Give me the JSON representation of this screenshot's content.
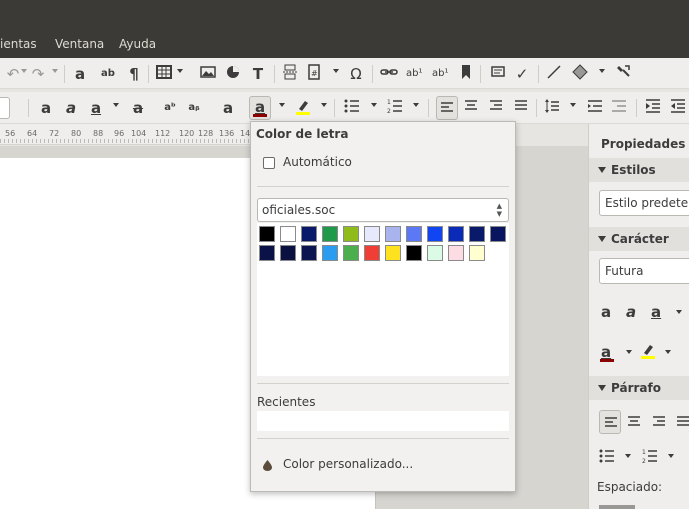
{
  "menubar": {
    "items": [
      "ientas",
      "Ventana",
      "Ayuda"
    ]
  },
  "toolbar1": {
    "icons": [
      "undo-icon",
      "redo-icon",
      "find-replace-icon",
      "spelling-icon",
      "formatting-marks-icon",
      "table-icon",
      "image-icon",
      "chart-icon",
      "textbox-icon",
      "page-break-icon",
      "field-icon",
      "special-character-icon",
      "hyperlink-icon",
      "footnote-icon",
      "endnote-icon",
      "bookmark-icon",
      "comment-icon",
      "track-changes-icon",
      "line-icon",
      "shapes-icon",
      "basic-shapes-icon",
      "clone-formatting-icon"
    ],
    "symbols": {
      "omega": "Ω",
      "pilcrow": "¶",
      "T": "T"
    }
  },
  "toolbar2": {
    "icons": [
      "bold-icon",
      "italic-icon",
      "underline-icon",
      "strikethrough-icon",
      "superscript-icon",
      "subscript-icon",
      "clear-formatting-icon",
      "font-color-icon",
      "highlight-icon",
      "bullets-icon",
      "numbering-icon",
      "align-left-icon",
      "align-center-icon",
      "align-right-icon",
      "justify-icon",
      "line-spacing-icon",
      "increase-indent-icon",
      "decrease-indent-icon"
    ]
  },
  "ruler": {
    "ticks": [
      "56",
      "64",
      "72",
      "80",
      "88",
      "96",
      "104",
      "112",
      "120",
      "128",
      "136",
      "14"
    ]
  },
  "popup": {
    "title": "Color de letra",
    "automatic_label": "Automático",
    "automatic_checked": false,
    "palette_name": "oficiales.soc",
    "swatches_row1": [
      "#000000",
      "#ffffff",
      "#0a1a6b",
      "#1f9a4a",
      "#8fbc1b",
      "#e6e8fb",
      "#a9b4ee",
      "#5d78f4",
      "#1145f2",
      "#0a2ab8",
      "#0a1a6b",
      "#0a1560"
    ],
    "swatches_row2": [
      "#0a1248",
      "#0a1040",
      "#0b1550",
      "#2b9df0",
      "#4cae4c",
      "#ef3e36",
      "#ffe21f",
      "#000000",
      "#dcfbe6",
      "#fddde3",
      "#ffffd0"
    ],
    "recent_label": "Recientes",
    "custom_label": "Color personalizado..."
  },
  "sidebar": {
    "title": "Propiedades",
    "styles_section": "Estilos",
    "style_value": "Estilo predeter",
    "character_section": "Carácter",
    "font_value": "Futura",
    "paragraph_section": "Párrafo",
    "spacing_label": "Espaciado:"
  },
  "colors": {
    "menubar_bg": "#3b3a36",
    "toolbar_bg": "#efeeec",
    "font_color_indicator": "#8b0000",
    "highlight_indicator": "#ffff00"
  }
}
